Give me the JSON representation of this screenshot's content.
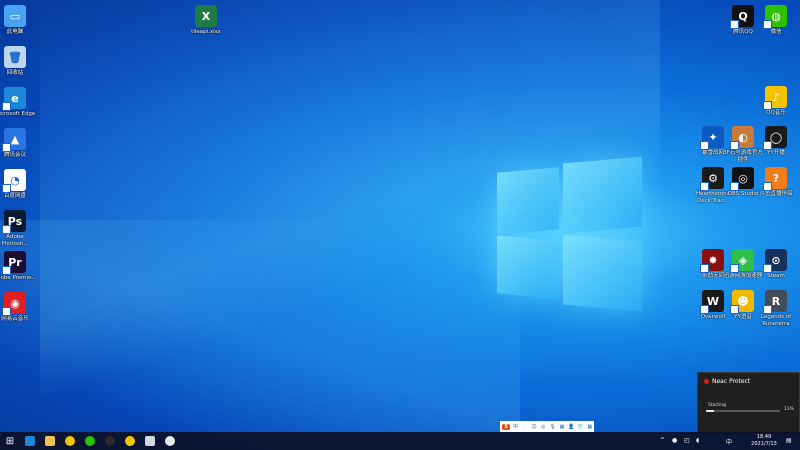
{
  "desktop": {
    "icons_left": [
      {
        "label": "此电脑",
        "color": "#4aa3f0",
        "glyph": "▭"
      },
      {
        "label": "回收站",
        "color": "#bcd7ee",
        "glyph": "🗑"
      },
      {
        "label": "Microsoft Edge",
        "color": "#1e88d8",
        "glyph": "e"
      },
      {
        "label": "腾讯会议",
        "color": "#2b74e6",
        "glyph": "▲"
      },
      {
        "label": "百度网盘",
        "color": "#ffffff",
        "glyph": "◔"
      },
      {
        "label": "Adobe Photosh...",
        "color": "#0a1a33",
        "glyph": "Ps"
      },
      {
        "label": "Adobe Premie...",
        "color": "#1c0b2e",
        "glyph": "Pr"
      },
      {
        "label": "网易云音乐",
        "color": "#e01e24",
        "glyph": "◉"
      }
    ],
    "icon_top": [
      {
        "label": "tileapi.xlsx",
        "color": "#1f7a45",
        "glyph": "X"
      }
    ],
    "icons_right": [
      {
        "label": "腾讯QQ",
        "color": "#111111",
        "glyph": "Q"
      },
      {
        "label": "微信",
        "color": "#2dc100",
        "glyph": "◍"
      },
      {
        "label": "QQ音乐",
        "color": "#f5c400",
        "glyph": "♪"
      },
      {
        "label": "暴雪战网",
        "color": "#0d5ac0",
        "glyph": "✦"
      },
      {
        "label": "3F石号游戏官方插件",
        "color": "#c77a3a",
        "glyph": "◐"
      },
      {
        "label": "YY开播",
        "color": "#1a1a1a",
        "glyph": "◯"
      },
      {
        "label": "Hearthstone Deck Trac...",
        "color": "#1a1a1a",
        "glyph": "⚙"
      },
      {
        "label": "OBS Studio",
        "color": "#111111",
        "glyph": "◎"
      },
      {
        "label": "斗鱼直播伴侣",
        "color": "#f07c1a",
        "glyph": "?"
      },
      {
        "label": "永劫无间",
        "color": "#8a1010",
        "glyph": "✸"
      },
      {
        "label": "迅游网游加速器",
        "color": "#2dbf4a",
        "glyph": "◈"
      },
      {
        "label": "Steam",
        "color": "#16325c",
        "glyph": "⊙"
      },
      {
        "label": "Overwolf",
        "color": "#1a1a1a",
        "glyph": "W"
      },
      {
        "label": "YY语音",
        "color": "#f5b800",
        "glyph": "☻"
      },
      {
        "label": "Legends of Runeterra",
        "color": "#444b5a",
        "glyph": "R"
      }
    ]
  },
  "notification": {
    "title": "Neac Protect",
    "status": "Starting",
    "percent_label": "11%",
    "progress": 0.11
  },
  "ime_bar": {
    "items": [
      "S",
      "中",
      "·",
      "☺",
      "◎",
      "🎙",
      "▦",
      "👤",
      "👕",
      "▦"
    ]
  },
  "taskbar": {
    "apps": [
      {
        "name": "start",
        "glyph": "⊞",
        "color": "#ffffff"
      },
      {
        "name": "edge",
        "glyph": "",
        "color": "#1e88d8"
      },
      {
        "name": "file-explorer",
        "glyph": "",
        "color": "#f2c14e"
      },
      {
        "name": "qq-music",
        "glyph": "",
        "color": "#f5c400"
      },
      {
        "name": "wechat",
        "glyph": "",
        "color": "#2dc100"
      },
      {
        "name": "obs",
        "glyph": "",
        "color": "#2a2a2a"
      },
      {
        "name": "yy",
        "glyph": "",
        "color": "#f5c400"
      },
      {
        "name": "files",
        "glyph": "",
        "color": "#cfd8e3"
      },
      {
        "name": "disk",
        "glyph": "",
        "color": "#e6e6e6"
      }
    ],
    "tray_ime": "中",
    "time": "18:49",
    "date": "2021/7/13"
  }
}
